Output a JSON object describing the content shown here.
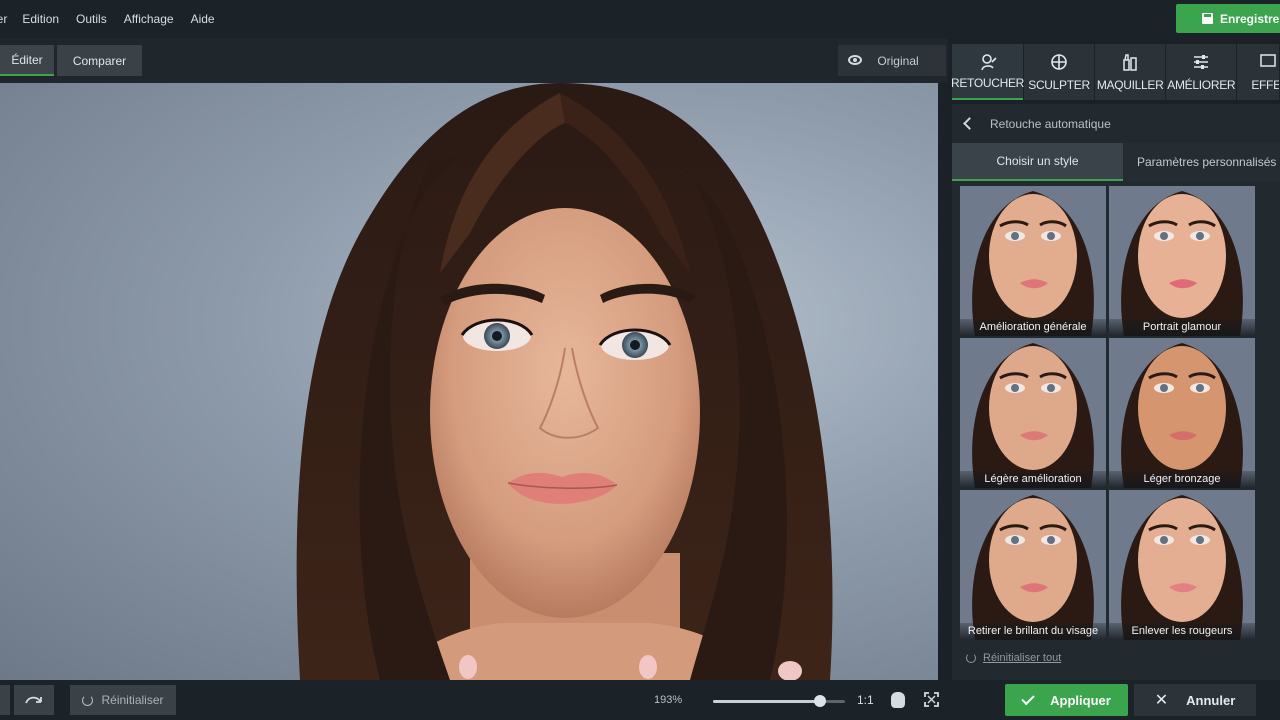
{
  "menu": {
    "items": [
      "ier",
      "Edition",
      "Outils",
      "Affichage",
      "Aide"
    ],
    "save_label": "Enregistrer"
  },
  "toolbar": {
    "edit_label": "Éditer",
    "compare_label": "Comparer",
    "original_label": "Original"
  },
  "tool_tabs": [
    {
      "label": "RETOUCHER",
      "icon": "retouch-icon",
      "active": true
    },
    {
      "label": "SCULPTER",
      "icon": "sculpt-icon",
      "active": false
    },
    {
      "label": "MAQUILLER",
      "icon": "makeup-icon",
      "active": false
    },
    {
      "label": "AMÉLIORER",
      "icon": "sliders-icon",
      "active": false
    },
    {
      "label": "EFFE",
      "icon": "effects-icon",
      "active": false
    }
  ],
  "panel": {
    "back_title": "Retouche automatique",
    "subtabs": {
      "style": "Choisir un style",
      "custom": "Paramètres personnalisés"
    },
    "presets": [
      "Amélioration générale",
      "Portrait glamour",
      "Légère amélioration",
      "Léger bronzage",
      "Retirer le brillant du visage",
      "Enlever les rougeurs"
    ],
    "reset_all": "Réinitialiser tout"
  },
  "bottom": {
    "reset_label": "Réinitialiser",
    "zoom": "193%",
    "zoom_level": 0.81,
    "one_to_one": "1:1",
    "apply_label": "Appliquer",
    "cancel_label": "Annuler"
  },
  "colors": {
    "accent": "#3aa54c",
    "background": "#1b2126",
    "panel": "#222a30"
  }
}
